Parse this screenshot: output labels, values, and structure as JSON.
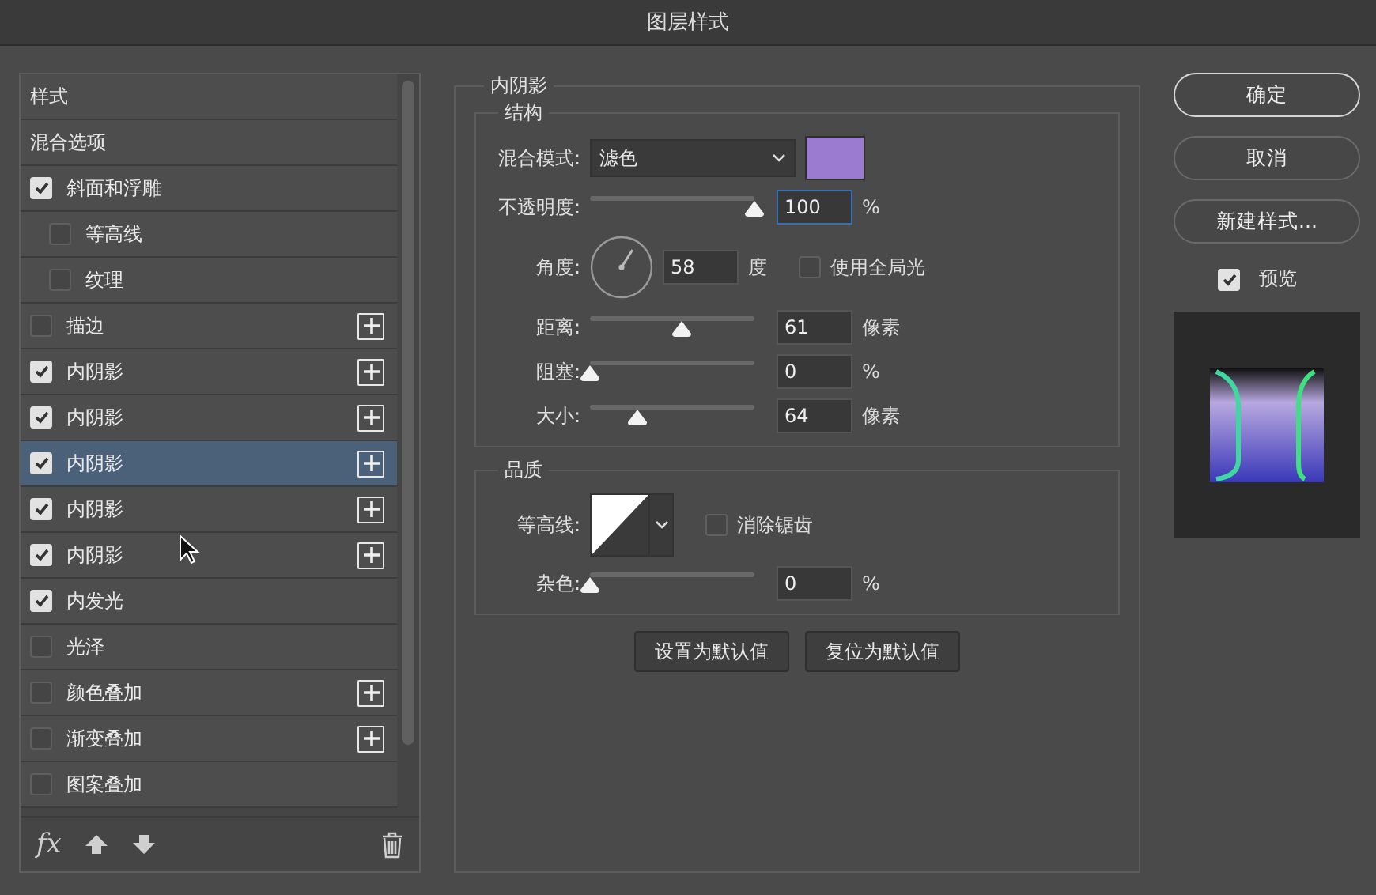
{
  "window": {
    "title": "图层样式"
  },
  "styles": [
    {
      "label": "样式",
      "kind": "header",
      "selected": false
    },
    {
      "label": "混合选项",
      "kind": "header",
      "selected": false
    },
    {
      "label": "斜面和浮雕",
      "kind": "effect",
      "checked": true,
      "addable": false,
      "selected": false,
      "children": [
        {
          "label": "等高线",
          "kind": "effect",
          "checked": false,
          "addable": false,
          "selected": false
        },
        {
          "label": "纹理",
          "kind": "effect",
          "checked": false,
          "addable": false,
          "selected": false
        }
      ]
    },
    {
      "label": "描边",
      "kind": "effect",
      "checked": false,
      "addable": true,
      "selected": false
    },
    {
      "label": "内阴影",
      "kind": "effect",
      "checked": true,
      "addable": true,
      "selected": false
    },
    {
      "label": "内阴影",
      "kind": "effect",
      "checked": true,
      "addable": true,
      "selected": false
    },
    {
      "label": "内阴影",
      "kind": "effect",
      "checked": true,
      "addable": true,
      "selected": true
    },
    {
      "label": "内阴影",
      "kind": "effect",
      "checked": true,
      "addable": true,
      "selected": false
    },
    {
      "label": "内阴影",
      "kind": "effect",
      "checked": true,
      "addable": true,
      "selected": false
    },
    {
      "label": "内发光",
      "kind": "effect",
      "checked": true,
      "addable": false,
      "selected": false
    },
    {
      "label": "光泽",
      "kind": "effect",
      "checked": false,
      "addable": false,
      "selected": false
    },
    {
      "label": "颜色叠加",
      "kind": "effect",
      "checked": false,
      "addable": true,
      "selected": false
    },
    {
      "label": "渐变叠加",
      "kind": "effect",
      "checked": false,
      "addable": true,
      "selected": false
    },
    {
      "label": "图案叠加",
      "kind": "effect",
      "checked": false,
      "addable": false,
      "selected": false
    }
  ],
  "list_toolbar": {
    "fx_label": "fx"
  },
  "settings": {
    "title": "内阴影",
    "structure": {
      "title": "结构",
      "blend_mode": {
        "label": "混合模式:",
        "value": "滤色",
        "color": "#9a7bd0"
      },
      "opacity": {
        "label": "不透明度:",
        "level": 1,
        "value": "100",
        "unit": "%",
        "focused": true
      },
      "angle": {
        "label": "角度:",
        "value": "58",
        "unit": "度"
      },
      "global_light": {
        "label": "使用全局光",
        "checked": false
      },
      "sliders": [
        {
          "label": "距离:",
          "level": 0.56,
          "value": "61",
          "unit": "像素"
        },
        {
          "label": "阻塞:",
          "level": 0,
          "value": "0",
          "unit": "%"
        },
        {
          "label": "大小:",
          "level": 0.29,
          "value": "64",
          "unit": "像素"
        }
      ]
    },
    "quality": {
      "title": "品质",
      "contour": {
        "label": "等高线:"
      },
      "anti_alias": {
        "label": "消除锯齿",
        "checked": false
      },
      "noise": {
        "label": "杂色:",
        "level": 0,
        "value": "0",
        "unit": "%"
      }
    },
    "buttons": [
      "设置为默认值",
      "复位为默认值"
    ]
  },
  "actions": [
    {
      "label": "确定",
      "primary": true
    },
    {
      "label": "取消",
      "primary": false
    },
    {
      "label": "新建样式...",
      "primary": false
    }
  ],
  "preview": {
    "label": "预览",
    "checked": true
  }
}
